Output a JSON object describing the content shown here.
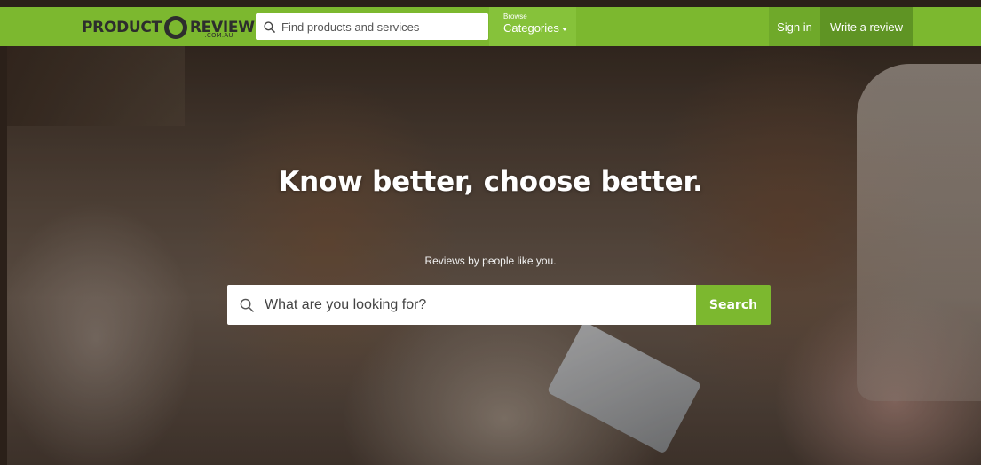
{
  "header": {
    "logo": {
      "left_word": "PRODUCT",
      "right_word": "REVIEW",
      "domain": ".COM.AU"
    },
    "search": {
      "placeholder": "Find products and services"
    },
    "browse": {
      "small_label": "Browse",
      "main_label": "Categories"
    },
    "sign_in_label": "Sign in",
    "write_review_label": "Write a review"
  },
  "hero": {
    "title": "Know better, choose better.",
    "subtitle": "Reviews by people like you.",
    "search": {
      "placeholder": "What are you looking for?",
      "button_label": "Search"
    }
  },
  "icons": {
    "header_search": "search-icon",
    "browse_caret": "caret-down-icon",
    "hero_search": "search-icon",
    "logo": "logo-badge-icon"
  },
  "colors": {
    "brand_green": "#7cb82f",
    "browse_green": "#86c23a",
    "signin_green": "#6fa92a",
    "write_review_green": "#5f9424",
    "logo_dark": "#2d2d2d"
  }
}
